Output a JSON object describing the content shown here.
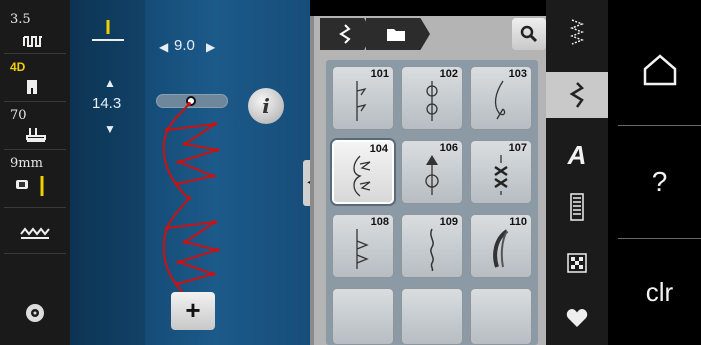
{
  "left_bar": {
    "items": [
      {
        "value": "3.5",
        "icon": "stitch-width-icon"
      },
      {
        "value": "4D",
        "icon": "presser-foot-icon",
        "highlight": true
      },
      {
        "value": "70",
        "icon": "needle-plate-icon"
      },
      {
        "value": "9mm",
        "icon": "needle-width-icon"
      },
      {
        "value": "",
        "icon": "feed-dog-icon"
      },
      {
        "value": "",
        "icon": "bobbin-icon"
      }
    ]
  },
  "stitch_view": {
    "width_value": "9.0",
    "length_value": "14.3",
    "stitch_color": "#cc1111",
    "plus_label": "+",
    "info_label": "i"
  },
  "grid_header": {
    "tabs": [
      "stitch-icon",
      "folder-icon"
    ],
    "search_icon": "search-icon"
  },
  "tiles": [
    {
      "number": "101",
      "selected": false
    },
    {
      "number": "102",
      "selected": false
    },
    {
      "number": "103",
      "selected": false
    },
    {
      "number": "104",
      "selected": true
    },
    {
      "number": "106",
      "selected": false
    },
    {
      "number": "107",
      "selected": false
    },
    {
      "number": "108",
      "selected": false
    },
    {
      "number": "109",
      "selected": false
    },
    {
      "number": "110",
      "selected": false
    }
  ],
  "categories": [
    {
      "name": "practical-stitch-icon",
      "active": false
    },
    {
      "name": "decorative-stitch-icon",
      "active": true
    },
    {
      "name": "alphabet-icon",
      "label": "A",
      "active": false
    },
    {
      "name": "buttonhole-icon",
      "active": false
    },
    {
      "name": "quilt-icon",
      "active": false
    },
    {
      "name": "favorites-icon",
      "active": false
    }
  ],
  "right_bar": {
    "home_icon": "home-icon",
    "help_label": "?",
    "clear_label": "clr"
  },
  "colors": {
    "accent_yellow": "#f0d000",
    "stitch_red": "#cc1111",
    "panel_blue": "#1c5a8a"
  }
}
